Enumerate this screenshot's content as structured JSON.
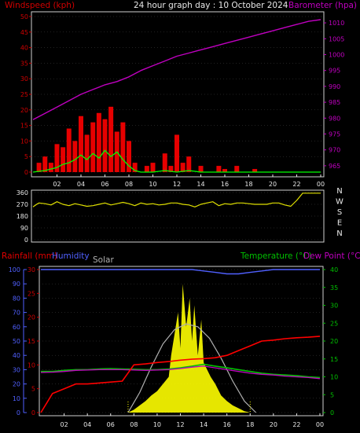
{
  "header": {
    "windspeed_label": "Windspeed (kph)",
    "title": "24 hour graph day : 10 October 2024",
    "barometer_label": "Barometer (hpa)"
  },
  "bottom_header": {
    "rainfall_label": "Rainfall (mm)",
    "humidity_label": "Humidity",
    "solar_label": "Solar",
    "temperature_label": "Temperature (°C)",
    "dewpoint_label": "Dew Point (°C)"
  },
  "compass": [
    "N",
    "W",
    "S",
    "E",
    "N"
  ],
  "colors": {
    "wind": "#ff0000",
    "wind_avg": "#00ff00",
    "wind_light": "#e8e8e8",
    "barometer": "#c000c0",
    "direction": "#e0e000",
    "rain": "#ff0000",
    "humidity": "#5060ff",
    "temperature": "#00c000",
    "dewpoint": "#c000c0",
    "solar": "#ffff00",
    "solar_theoretical": "#b0b0b0",
    "frame": "#d0d0d0",
    "grid": "#555555"
  },
  "chart_data": [
    {
      "type": "line",
      "name": "wind-barometer",
      "x_ticks": [
        "02",
        "04",
        "06",
        "08",
        "10",
        "12",
        "14",
        "16",
        "18",
        "20",
        "22",
        "00"
      ],
      "xlim": [
        0,
        24
      ],
      "windspeed_axis": {
        "ticks": [
          "0",
          "5",
          "10",
          "15",
          "20",
          "25",
          "30",
          "35",
          "40",
          "45",
          "50"
        ],
        "ylim": [
          0,
          50
        ]
      },
      "barometer_axis": {
        "ticks": [
          "965",
          "970",
          "975",
          "980",
          "985",
          "990",
          "995",
          "1000",
          "1005",
          "1010"
        ],
        "ylim": [
          963,
          1012
        ]
      },
      "barometer": {
        "x": [
          0,
          1,
          2,
          3,
          4,
          5,
          6,
          7,
          8,
          9,
          10,
          11,
          12,
          13,
          14,
          15,
          16,
          17,
          18,
          19,
          20,
          21,
          22,
          23,
          24
        ],
        "y": [
          979.5,
          981.5,
          983.5,
          985.5,
          987.5,
          989.0,
          990.5,
          991.5,
          993.0,
          995.0,
          996.5,
          998.0,
          999.5,
          1000.5,
          1001.5,
          1002.5,
          1003.5,
          1004.5,
          1005.5,
          1006.5,
          1007.5,
          1008.5,
          1009.5,
          1010.5,
          1011.0
        ]
      },
      "wind_gust": {
        "x": [
          0,
          0.5,
          1,
          1.5,
          2,
          2.5,
          3,
          3.5,
          4,
          4.5,
          5,
          5.5,
          6,
          6.5,
          7,
          7.5,
          8,
          8.5,
          9,
          9.5,
          10,
          10.5,
          11,
          11.5,
          12,
          12.5,
          13,
          13.5,
          14,
          14.5,
          15,
          15.5,
          16,
          16.5,
          17,
          17.5,
          18,
          18.5,
          19,
          19.5,
          20,
          20.5,
          21,
          21.5,
          22,
          22.5,
          23,
          23.5,
          24
        ],
        "y": [
          0,
          3,
          5,
          3,
          9,
          8,
          14,
          10,
          18,
          12,
          16,
          19,
          17,
          21,
          13,
          16,
          10,
          3,
          0,
          2,
          3,
          0,
          6,
          2,
          12,
          3,
          5,
          0,
          2,
          0,
          0,
          2,
          1,
          0,
          2,
          0,
          0,
          1,
          0,
          0,
          0,
          0,
          0,
          0,
          0,
          0,
          0,
          0,
          0
        ]
      },
      "wind_avg": {
        "x": [
          0,
          1,
          2,
          2.5,
          3,
          3.5,
          4,
          4.5,
          5,
          5.5,
          6,
          6.5,
          7,
          7.5,
          8,
          8.5,
          9,
          10,
          11,
          12,
          13,
          14,
          15,
          16,
          18,
          20,
          22,
          24
        ],
        "y": [
          0,
          0.5,
          1.5,
          2.5,
          3,
          4,
          5.5,
          4,
          6,
          4.5,
          7,
          5,
          6.5,
          4,
          2,
          0.5,
          0,
          0,
          0.5,
          0,
          0.5,
          0,
          0,
          0,
          0,
          0,
          0,
          0
        ]
      }
    },
    {
      "type": "line",
      "name": "wind-direction",
      "x_ticks": [
        "02",
        "04",
        "06",
        "08",
        "10",
        "12",
        "14",
        "16",
        "18",
        "20",
        "22",
        "00"
      ],
      "y_ticks": [
        "0",
        "90",
        "180",
        "270",
        "360"
      ],
      "ylim": [
        0,
        360
      ],
      "x": [
        0,
        0.3,
        0.5,
        1,
        1.5,
        2,
        2.5,
        3,
        3.5,
        4,
        4.5,
        5,
        5.5,
        6,
        6.5,
        7,
        7.5,
        8,
        8.5,
        9,
        9.5,
        10,
        10.5,
        11,
        11.5,
        12,
        12.5,
        13,
        13.5,
        14,
        14.5,
        15,
        15.5,
        16,
        16.5,
        17,
        17.5,
        18,
        18.5,
        19,
        19.5,
        20,
        20.5,
        21,
        21.5,
        22,
        22.5,
        23,
        23.5,
        24
      ],
      "y": [
        250,
        270,
        280,
        275,
        265,
        290,
        270,
        260,
        275,
        265,
        255,
        260,
        270,
        280,
        265,
        275,
        285,
        275,
        260,
        280,
        270,
        275,
        265,
        270,
        280,
        280,
        270,
        265,
        250,
        270,
        280,
        290,
        260,
        275,
        270,
        280,
        280,
        275,
        270,
        270,
        270,
        280,
        280,
        265,
        255,
        300,
        355,
        355,
        355,
        355
      ]
    },
    {
      "type": "line",
      "name": "rain-humidity-temperature",
      "x_ticks": [
        "02",
        "04",
        "06",
        "08",
        "10",
        "12",
        "14",
        "16",
        "18",
        "20",
        "22",
        "00"
      ],
      "humidity_axis": {
        "ticks": [
          "0",
          "10",
          "20",
          "30",
          "40",
          "50",
          "60",
          "70",
          "80",
          "90",
          "100"
        ],
        "ylim": [
          0,
          100
        ]
      },
      "rainfall_axis": {
        "ticks": [
          "0",
          "5",
          "10",
          "15",
          "20",
          "25",
          "30"
        ],
        "ylim": [
          0,
          30
        ]
      },
      "temperature_axis": {
        "ticks": [
          "0",
          "5",
          "10",
          "15",
          "20",
          "25",
          "30",
          "35",
          "40"
        ],
        "ylim": [
          0,
          40
        ]
      },
      "rainfall": {
        "x": [
          0,
          0.5,
          1,
          2,
          3,
          4,
          5,
          6,
          7,
          8,
          9,
          10,
          11,
          12,
          13,
          14,
          15,
          16,
          17,
          18,
          19,
          20,
          21,
          22,
          23,
          24
        ],
        "y": [
          0,
          2,
          4,
          5,
          6,
          6,
          6.2,
          6.4,
          6.6,
          10,
          10.2,
          10.5,
          10.7,
          11,
          11.2,
          11.3,
          11.5,
          12,
          13,
          14,
          15,
          15.2,
          15.5,
          15.7,
          15.8,
          16
        ]
      },
      "humidity": {
        "x": [
          0,
          1,
          2,
          3,
          4,
          5,
          6,
          7,
          8,
          9,
          10,
          11,
          12,
          13,
          14,
          15,
          16,
          17,
          18,
          19,
          20,
          21,
          22,
          23,
          24
        ],
        "y": [
          100,
          100,
          100,
          100,
          100,
          100,
          100,
          100,
          100,
          100,
          100,
          100,
          100,
          100,
          99,
          98,
          97,
          97,
          98,
          99,
          100,
          100,
          100,
          100,
          100
        ]
      },
      "temperature": {
        "x": [
          0,
          1,
          2,
          3,
          4,
          5,
          6,
          7,
          8,
          9,
          10,
          11,
          12,
          13,
          14,
          15,
          16,
          17,
          18,
          19,
          20,
          21,
          22,
          23,
          24
        ],
        "y": [
          11.5,
          11.5,
          11.8,
          12,
          12,
          12.2,
          12.3,
          12.2,
          12.1,
          12,
          12,
          12.2,
          12.5,
          13,
          13.5,
          13,
          12.5,
          12,
          11.5,
          11,
          10.7,
          10.5,
          10.3,
          10,
          9.8
        ]
      },
      "dewpoint": {
        "x": [
          0,
          1,
          2,
          3,
          4,
          5,
          6,
          7,
          8,
          9,
          10,
          11,
          12,
          13,
          14,
          15,
          16,
          17,
          18,
          19,
          20,
          21,
          22,
          23,
          24
        ],
        "y": [
          11.2,
          11.3,
          11.5,
          11.8,
          11.9,
          12,
          12,
          12,
          11.9,
          11.8,
          11.9,
          12,
          12.3,
          12.7,
          13,
          12.5,
          12,
          11.5,
          11,
          10.7,
          10.5,
          10.2,
          10,
          9.8,
          9.5
        ]
      },
      "solar": {
        "x": [
          7.5,
          8,
          8.5,
          9,
          9.5,
          10,
          10.5,
          11,
          11.2,
          11.5,
          11.8,
          12,
          12.2,
          12.5,
          12.8,
          13,
          13.2,
          13.5,
          13.8,
          14,
          14.3,
          14.6,
          15,
          15.5,
          16,
          16.5,
          17,
          17.5,
          18
        ],
        "y": [
          0,
          2,
          5,
          8,
          12,
          15,
          20,
          25,
          40,
          55,
          70,
          45,
          90,
          60,
          80,
          50,
          75,
          40,
          65,
          35,
          30,
          25,
          20,
          12,
          8,
          5,
          3,
          1,
          0
        ]
      },
      "solar_theoretical": {
        "x": [
          7.5,
          8.5,
          9.5,
          10.5,
          11.5,
          12.5,
          13.5,
          14.5,
          15.5,
          16.5,
          17.5,
          18.5
        ],
        "y": [
          0,
          14,
          32,
          48,
          58,
          62,
          60,
          52,
          38,
          22,
          8,
          0
        ]
      }
    }
  ]
}
